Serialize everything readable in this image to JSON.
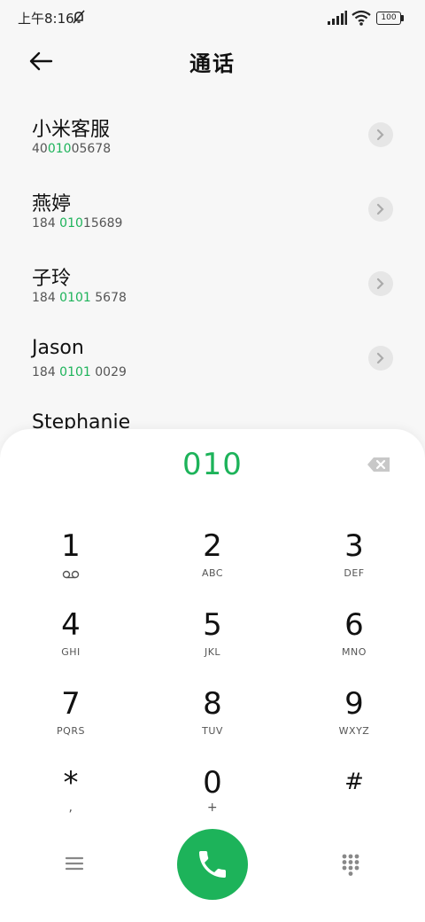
{
  "status_bar": {
    "time": "上午8:16",
    "battery": "100"
  },
  "header": {
    "title": "通话"
  },
  "contacts": [
    {
      "name": "小米客服",
      "number_pre": "40",
      "number_hl": "010",
      "number_post": "05678"
    },
    {
      "name": "燕婷",
      "number_pre": "184 ",
      "number_hl": "010",
      "number_post": "15689"
    },
    {
      "name": "子玲",
      "number_pre": "184 ",
      "number_hl": "0101",
      "number_post": " 5678"
    },
    {
      "name": "Jason",
      "number_pre": "184 ",
      "number_hl": "0101",
      "number_post": " 0029"
    },
    {
      "name": "Stephanie",
      "number_pre": "",
      "number_hl": "",
      "number_post": ""
    }
  ],
  "dialer": {
    "input_value": "010",
    "keys": [
      {
        "digit": "1",
        "letters": ""
      },
      {
        "digit": "2",
        "letters": "ABC"
      },
      {
        "digit": "3",
        "letters": "DEF"
      },
      {
        "digit": "4",
        "letters": "GHI"
      },
      {
        "digit": "5",
        "letters": "JKL"
      },
      {
        "digit": "6",
        "letters": "MNO"
      },
      {
        "digit": "7",
        "letters": "PQRS"
      },
      {
        "digit": "8",
        "letters": "TUV"
      },
      {
        "digit": "9",
        "letters": "WXYZ"
      },
      {
        "digit": "*",
        "letters": ","
      },
      {
        "digit": "0",
        "letters": "+"
      },
      {
        "digit": "#",
        "letters": ""
      }
    ]
  },
  "colors": {
    "accent": "#1db35a",
    "background": "#f7f7f7",
    "panel": "#ffffff"
  },
  "icons": {
    "back": "arrow-left-icon",
    "dnd": "do-not-disturb-icon",
    "signal": "signal-icon",
    "wifi": "wifi-icon",
    "battery": "battery-icon",
    "chevron": "chevron-right-icon",
    "backspace": "backspace-icon",
    "voicemail": "voicemail-icon",
    "menu": "menu-icon",
    "call": "phone-icon",
    "keypad": "dialpad-icon"
  }
}
